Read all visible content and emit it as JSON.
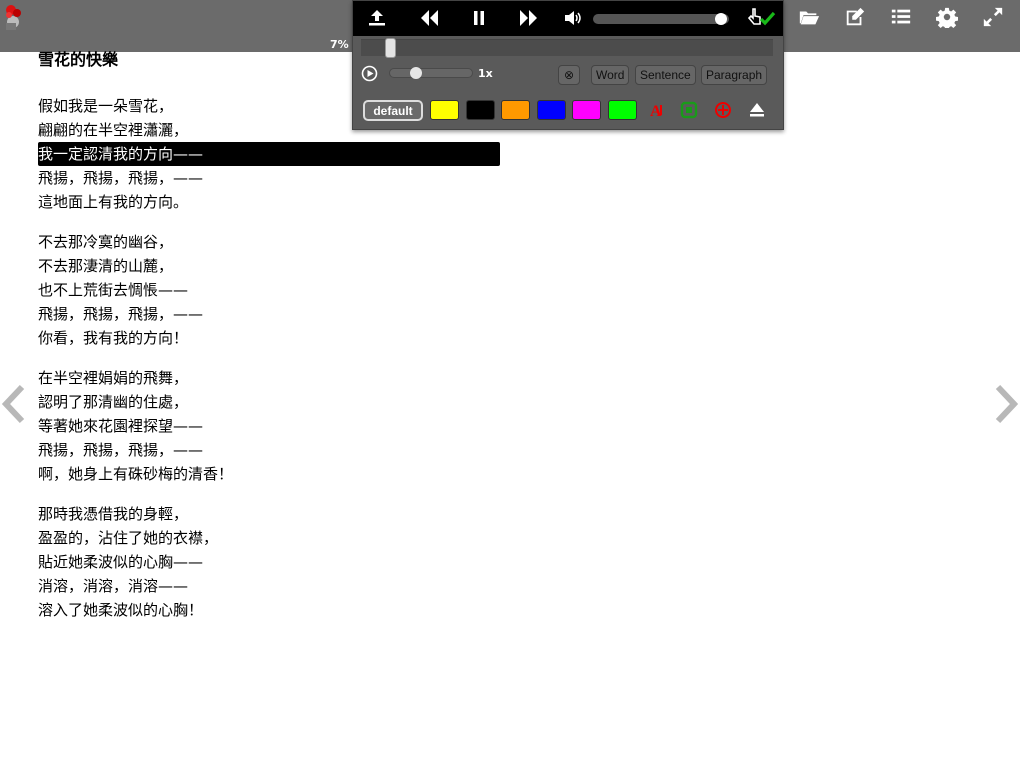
{
  "toolbar": {
    "progress": "7%",
    "tools": [
      {
        "name": "folder-open-icon"
      },
      {
        "name": "edit-icon"
      },
      {
        "name": "list-icon"
      },
      {
        "name": "gear-icon"
      },
      {
        "name": "fullscreen-icon"
      }
    ]
  },
  "player": {
    "volume_fraction": 0.98,
    "seek_fraction": 0.06,
    "speed_label": "1x",
    "speed_fraction": 0.28,
    "clear_symbol": "⊗",
    "modes": {
      "word": "Word",
      "sentence": "Sentence",
      "paragraph": "Paragraph"
    },
    "default_label": "default",
    "colors": [
      "#ffff00",
      "#000000",
      "#ff9900",
      "#0000ff",
      "#ff00ff",
      "#00ff00"
    ]
  },
  "poem": {
    "title": "雪花的快樂",
    "stanzas": [
      [
        "假如我是一朵雪花，",
        "翩翩的在半空裡瀟灑，",
        "我一定認清我的方向——",
        "飛揚，飛揚，飛揚，——",
        "這地面上有我的方向。"
      ],
      [
        "不去那冷寞的幽谷，",
        "不去那淒清的山麓，",
        "也不上荒街去惆悵——",
        "飛揚，飛揚，飛揚，——",
        "你看，我有我的方向！"
      ],
      [
        "在半空裡娟娟的飛舞，",
        "認明了那清幽的住處，",
        "等著她來花園裡探望——",
        "飛揚，飛揚，飛揚，——",
        "啊，她身上有硃砂梅的清香！"
      ],
      [
        "那時我憑借我的身輕，",
        "盈盈的，沾住了她的衣襟，",
        "貼近她柔波似的心胸——",
        "消溶，消溶，消溶——",
        "溶入了她柔波似的心胸！"
      ]
    ],
    "highlighted_line": [
      0,
      2
    ]
  }
}
